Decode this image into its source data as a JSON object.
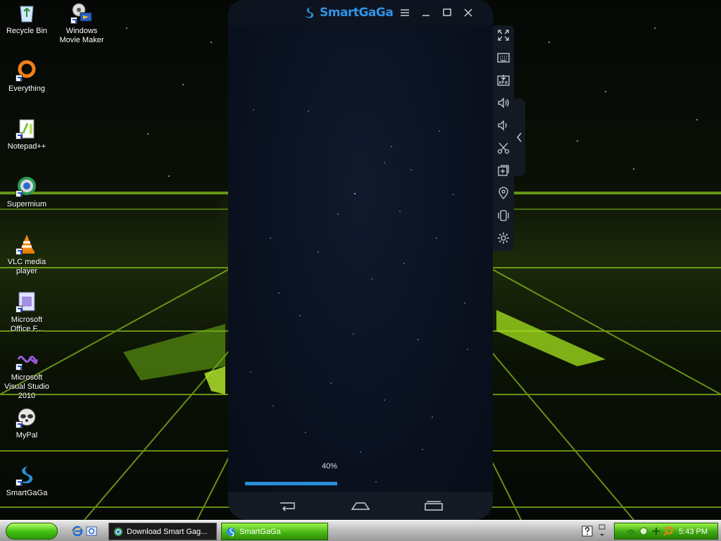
{
  "desktop": {
    "icons": [
      {
        "label": "Recycle Bin"
      },
      {
        "label": "Windows Movie Maker"
      },
      {
        "label": "Everything"
      },
      {
        "label": "Notepad++"
      },
      {
        "label": "Supermium"
      },
      {
        "label": "VLC media player"
      },
      {
        "label": "Microsoft Office F..."
      },
      {
        "label": "Microsoft Visual Studio 2010"
      },
      {
        "label": "MyPal"
      },
      {
        "label": "SmartGaGa"
      }
    ]
  },
  "window": {
    "title": "SmartGaGa",
    "accent": "#2a8ed6",
    "progress": {
      "label": "40%",
      "fraction": 0.4
    },
    "sidebar_icons": [
      "fullscreen-icon",
      "keyboard-icon",
      "apk-install-icon",
      "volume-up-icon",
      "volume-down-icon",
      "scissors-icon",
      "multi-instance-icon",
      "location-icon",
      "shake-icon",
      "settings-icon"
    ]
  },
  "taskbar": {
    "tasks": [
      {
        "label": "Download Smart Gag..."
      },
      {
        "label": "SmartGaGa"
      }
    ],
    "clock": "5:43 PM"
  }
}
